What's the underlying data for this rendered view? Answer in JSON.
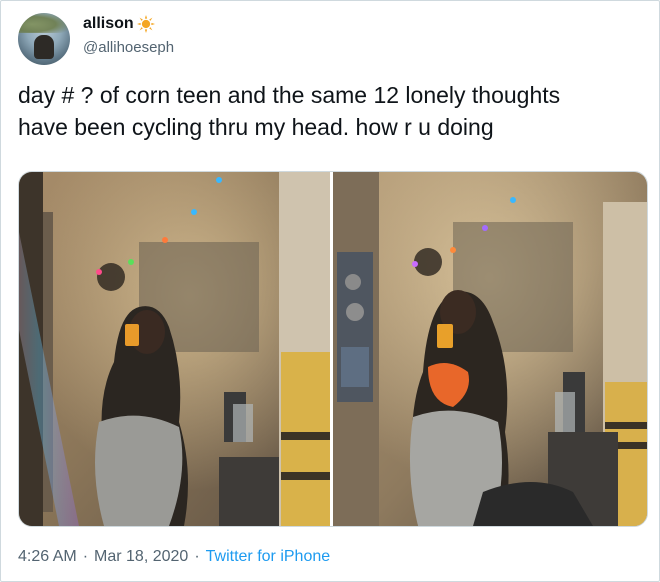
{
  "tweet": {
    "author_name": "allison",
    "author_handle": "@allihoeseph",
    "text_line1": "day # ? of corn teen and the same 12 lonely thoughts",
    "text_line2": "have been cycling thru my head. how r u doing",
    "time": "4:26 AM",
    "separator": "·",
    "date": "Mar 18, 2020",
    "source": "Twitter for iPhone"
  },
  "colors": {
    "accent": "#1d9bf0",
    "text_primary": "#0f1419",
    "text_secondary": "#536471",
    "border": "#cfd9de"
  },
  "icons": {
    "name_emoji": "sun-icon"
  }
}
